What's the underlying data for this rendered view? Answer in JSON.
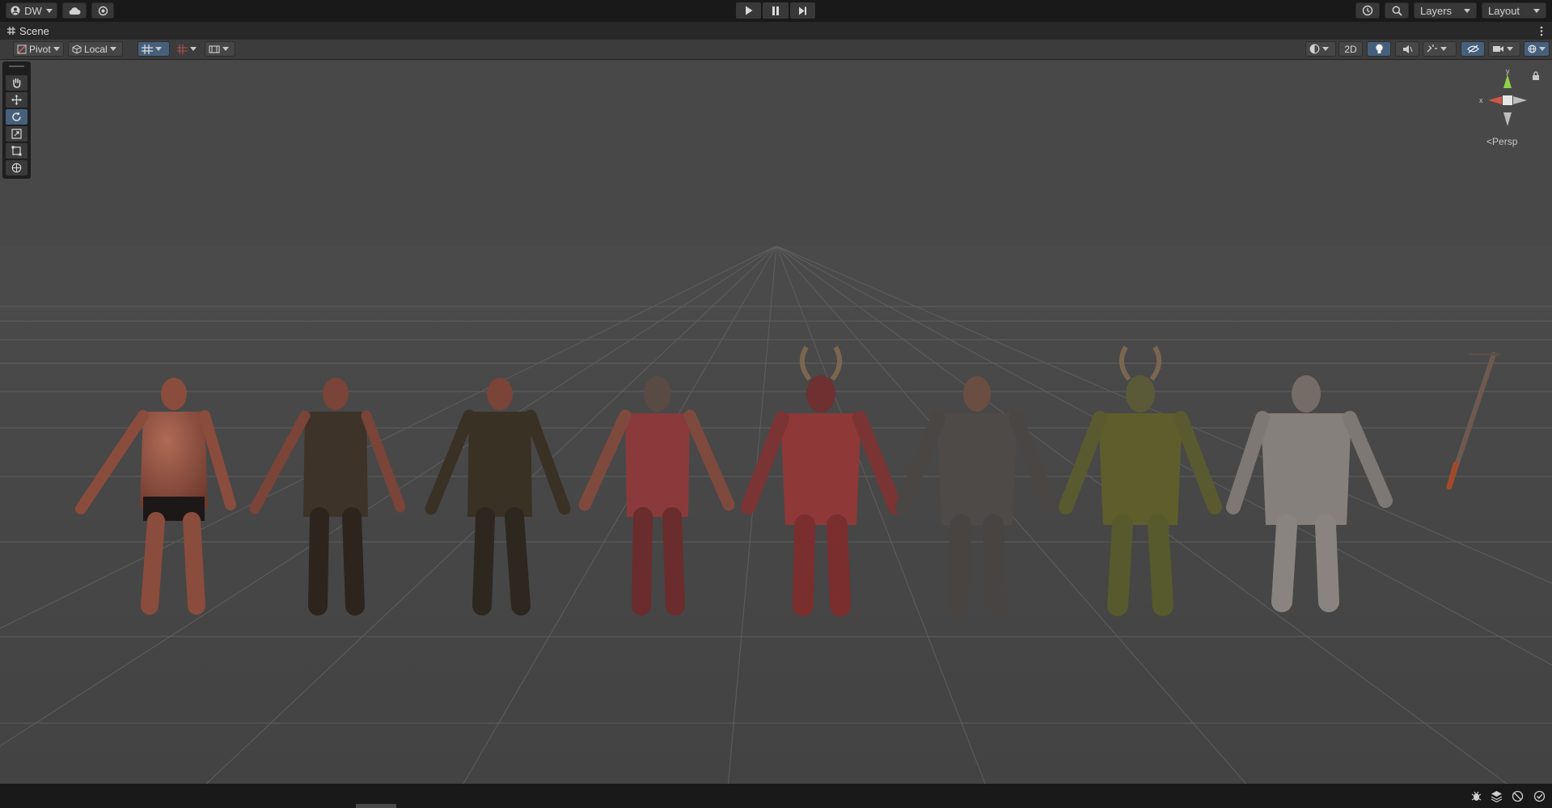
{
  "topbar": {
    "account_label": "DW",
    "layers_label": "Layers",
    "layout_label": "Layout"
  },
  "tab": {
    "title": "Scene"
  },
  "toolbar": {
    "pivot_label": "Pivot",
    "local_label": "Local",
    "mode_2d_label": "2D"
  },
  "gizmo": {
    "persp_label": "Persp",
    "x_label": "x",
    "y_label": "y"
  },
  "scene": {
    "objects": [
      "character-1",
      "character-2",
      "character-3",
      "character-4",
      "character-5",
      "character-6",
      "character-7",
      "character-8",
      "sword"
    ]
  },
  "colors": {
    "accent": "#46607c",
    "viewport_bg": "#464646",
    "grid_line": "#5a5a5a"
  }
}
